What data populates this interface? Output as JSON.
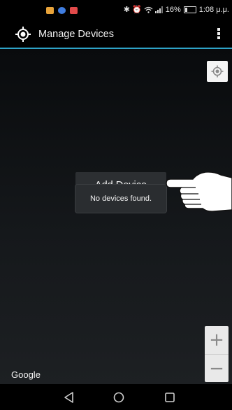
{
  "status_bar": {
    "battery": "16%",
    "time": "1:08 μ.μ.",
    "icons": [
      "bluetooth-icon",
      "alarm-icon",
      "wifi-icon",
      "signal-icon",
      "battery-icon"
    ],
    "notification_colors": [
      "#e8a33a",
      "#3f7de0",
      "#e24a4a"
    ]
  },
  "app_bar": {
    "title": "Manage Devices",
    "logo_icon": "crosshair-logo-icon",
    "menu_icon": "overflow-menu-icon",
    "accent": "#2ea3c7"
  },
  "map": {
    "locate_icon": "my-location-icon",
    "add_device_label": "Add Device",
    "toast_text": "No devices found.",
    "zoom_in_label": "+",
    "zoom_out_label": "−",
    "google_label": "Google"
  },
  "nav_bar": {
    "icons": [
      "back-icon",
      "home-icon",
      "recents-icon"
    ]
  }
}
